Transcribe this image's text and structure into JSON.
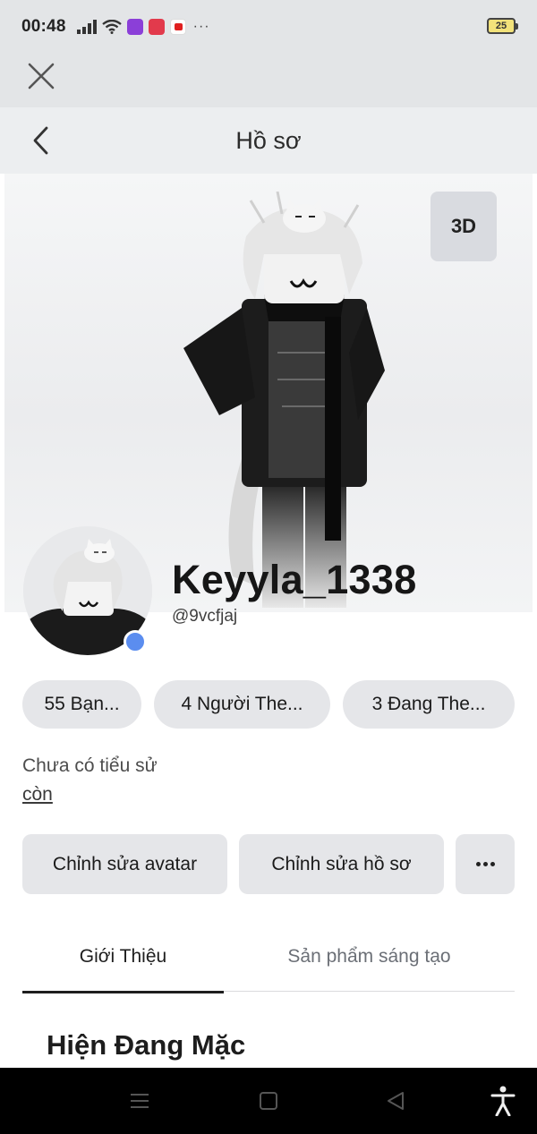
{
  "status_bar": {
    "time": "00:48",
    "battery": "25",
    "overflow": "···"
  },
  "header": {
    "title": "Hồ sơ"
  },
  "avatar_view": {
    "toggle_label": "3D"
  },
  "profile": {
    "display_name": "Keyyla_1338",
    "username": "@9vcfjaj",
    "status_color": "#5b8def"
  },
  "stats": [
    {
      "label": "55 Bạn..."
    },
    {
      "label": "4 Người The..."
    },
    {
      "label": "3 Đang The..."
    }
  ],
  "bio": {
    "text": "Chưa có tiểu sử",
    "more_link": "còn"
  },
  "actions": {
    "edit_avatar": "Chỉnh sửa avatar",
    "edit_profile": "Chỉnh sửa hồ sơ"
  },
  "tabs": [
    {
      "label": "Giới Thiệu",
      "active": true
    },
    {
      "label": "Sản phẩm sáng tạo",
      "active": false
    }
  ],
  "section": {
    "title": "Hiện Đang Mặc"
  },
  "icons": {
    "close": "close-icon",
    "back": "chevron-left-icon",
    "more": "more-horizontal-icon",
    "nav": [
      "menu-icon",
      "home-square-icon",
      "back-triangle-icon",
      "accessibility-icon"
    ]
  }
}
